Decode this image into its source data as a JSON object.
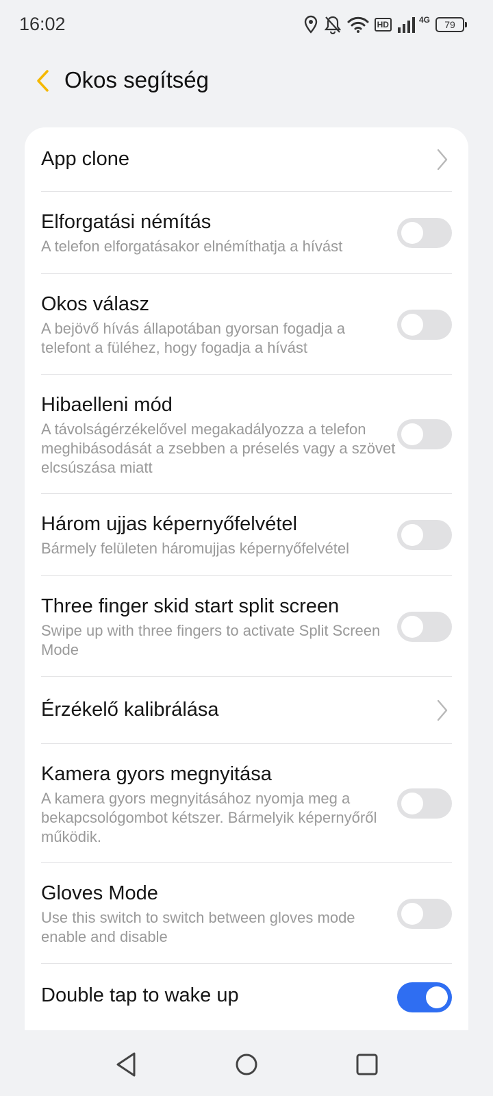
{
  "status_bar": {
    "time": "16:02",
    "icons": [
      "location-icon",
      "bell-off-icon",
      "wifi-icon",
      "hd-badge",
      "signal-icon",
      "battery-icon"
    ],
    "hd_label": "HD",
    "network_label": "4G",
    "battery_level": "79"
  },
  "header": {
    "back_icon": "chevron-left-icon",
    "title": "Okos segítség",
    "accent_color": "#f5b800"
  },
  "settings": [
    {
      "title": "App clone",
      "control": "chevron"
    },
    {
      "title": "Elforgatási némítás",
      "subtitle": "A telefon elforgatásakor elnémíthatja a hívást",
      "control": "toggle",
      "on": false
    },
    {
      "title": "Okos válasz",
      "subtitle": "A bejövő hívás állapotában gyorsan fogadja a telefont a füléhez, hogy fogadja a hívást",
      "control": "toggle",
      "on": false
    },
    {
      "title": "Hibaelleni mód",
      "subtitle": "A távolságérzékelővel megakadályozza a telefon meghibásodását a zsebben a préselés vagy a szövet elcsúszása miatt",
      "control": "toggle",
      "on": false
    },
    {
      "title": "Három ujjas képernyőfelvétel",
      "subtitle": "Bármely felületen háromujjas képernyőfelvétel",
      "control": "toggle",
      "on": false
    },
    {
      "title": "Three finger skid start split screen",
      "subtitle": "Swipe up with three fingers to activate Split Screen Mode",
      "control": "toggle",
      "on": false
    },
    {
      "title": "Érzékelő kalibrálása",
      "control": "chevron"
    },
    {
      "title": "Kamera gyors megnyitása",
      "subtitle": "A kamera gyors megnyitásához nyomja meg a bekapcsológombot kétszer. Bármelyik képernyőről működik.",
      "control": "toggle",
      "on": false
    },
    {
      "title": "Gloves Mode",
      "subtitle": "Use this switch to switch between gloves mode enable and disable",
      "control": "toggle",
      "on": false
    },
    {
      "title": "Double tap to wake up",
      "control": "toggle",
      "on": true
    }
  ],
  "toggle_on_color": "#2f6ef2",
  "nav_bar": {
    "buttons": [
      "back-triangle-icon",
      "home-circle-icon",
      "recents-square-icon"
    ]
  }
}
